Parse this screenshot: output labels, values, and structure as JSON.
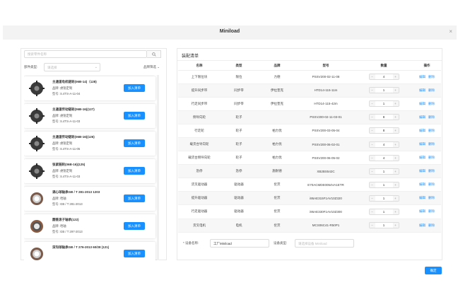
{
  "modal": {
    "title": "Miniload",
    "close_label": "×"
  },
  "left": {
    "search_placeholder": "搜索零件名称",
    "filter_label": "部件类型:",
    "filter_placeholder": "请选择",
    "brand_filter_label": "品牌筛选",
    "parts": [
      {
        "name": "主通道电机链轮(06B-14)（128)",
        "brand_line": "品牌: 虔锐定制",
        "model_line": "型号: S.4TS-A-11-04",
        "add_label": "加入清单"
      },
      {
        "name": "主通道传动链轮(06B-16)(127)",
        "brand_line": "品牌: 虔锐定制",
        "model_line": "型号: S.4TS-A-11-03",
        "add_label": "加入清单"
      },
      {
        "name": "主通道传动链轮(06B-16)(126)",
        "brand_line": "品牌: 虔锐定制",
        "model_line": "型号: S.4TS-A-11-05",
        "add_label": "加入清单"
      },
      {
        "name": "张紧链轮(06B-16)(125)",
        "brand_line": "品牌: 虔锐定制",
        "model_line": "型号: S.4TS-A-11-03",
        "add_label": "加入清单"
      },
      {
        "name": "调心球轴承GB / T 281-2013 1203",
        "brand_line": "品牌: 哈轴",
        "model_line": "型号: GB / T 281-2013",
        "add_label": "加入清单"
      },
      {
        "name": "圆锥滚子轴承(122)",
        "brand_line": "品牌: 哈轴",
        "model_line": "型号: GB / T 297-2013",
        "add_label": "加入清单"
      },
      {
        "name": "深沟球轴承GB / T 276-2013 60/28 (121)",
        "brand_line": "",
        "model_line": "",
        "add_label": "加入清单"
      }
    ]
  },
  "right": {
    "title": "装配清单",
    "columns": [
      "名称",
      "类型",
      "品牌",
      "型号",
      "数量",
      "操作"
    ],
    "edit_label": "编辑",
    "delete_label": "删除",
    "rows": [
      {
        "name": "上下限位块",
        "type": "限位",
        "brand": "力德",
        "model": "PSSV200-02-11-08",
        "qty": "4"
      },
      {
        "name": "提升同步带",
        "type": "同步带",
        "brand": "伊拉奎克",
        "model": "HTD14-115-11m",
        "qty": "1"
      },
      {
        "name": "行走同步带",
        "type": "同步带",
        "brand": "伊拉奎克",
        "model": "HTD14-115-42m",
        "qty": "1"
      },
      {
        "name": "侧导向轮",
        "type": "轮子",
        "brand": "",
        "model": "PSSV200-02-11-03-01",
        "qty": "8"
      },
      {
        "name": "行走轮",
        "type": "轮子",
        "brand": "柏力优",
        "model": "PSSV200-03-05-04",
        "qty": "8"
      },
      {
        "name": "载货台导向轮",
        "type": "轮子",
        "brand": "柏力优",
        "model": "PSSV200-06-02-01",
        "qty": "4"
      },
      {
        "name": "载货台侧导向轮",
        "type": "轮子",
        "brand": "柏力优",
        "model": "PSSV200-06-05-02",
        "qty": "4"
      },
      {
        "name": "急停",
        "type": "急停",
        "brand": "施耐德",
        "model": "XB2BS542C",
        "qty": "1"
      },
      {
        "name": "货叉驱动器",
        "type": "驱动器",
        "brand": "伦茨",
        "model": "E70ACMDE0054VA1ETR",
        "qty": "1"
      },
      {
        "name": "提升驱动器",
        "type": "驱动器",
        "brand": "伦茨",
        "model": "i95AE315F1AV10Z320",
        "qty": "1"
      },
      {
        "name": "行走驱动器",
        "type": "驱动器",
        "brand": "伦茨",
        "model": "i95AE330F1AV10Z300",
        "qty": "1"
      },
      {
        "name": "货叉电机",
        "type": "电机",
        "brand": "伦茨",
        "model": "MCS06C41-R50P1",
        "qty": "1"
      }
    ],
    "device_name_label": "* 设备名称:",
    "device_name_value": "工厂Miniload",
    "device_type_label": "设备类型:",
    "device_type_placeholder": "请选择设备 Miniload"
  },
  "footer": {
    "confirm_label": "确定"
  },
  "colors": {
    "primary": "#1890ff",
    "header_bg": "#f3f3f3"
  }
}
